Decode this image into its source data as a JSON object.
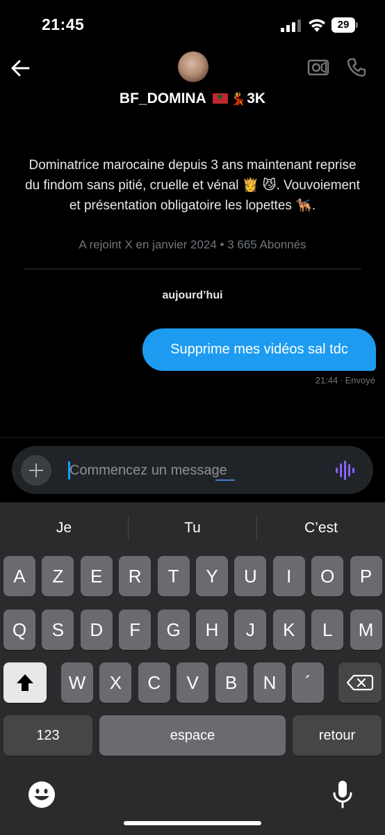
{
  "status_bar": {
    "time": "21:45",
    "battery": "29"
  },
  "header": {
    "username": "BF_DOMINA",
    "username_suffix": "3K",
    "flag": "morocco-flag",
    "emoji": "dancer-emoji"
  },
  "bio": {
    "text": "Dominatrice marocaine depuis 3 ans maintenant reprise du findom sans pitié, cruelle et vénal 👸 😼. Vouvoiement et présentation obligatoire les lopettes 🐕‍🦺.",
    "meta": "A rejoint X en janvier 2024 • 3 665 Abonnés"
  },
  "conversation": {
    "day_label": "aujourd’hui",
    "messages": [
      {
        "text": "Supprime mes vidéos sal tdc",
        "time": "21:44",
        "status": "Envoyé"
      }
    ]
  },
  "composer": {
    "placeholder": "Commencez un message"
  },
  "keyboard": {
    "suggestions": [
      "Je",
      "Tu",
      "C’est"
    ],
    "row1": [
      "A",
      "Z",
      "E",
      "R",
      "T",
      "Y",
      "U",
      "I",
      "O",
      "P"
    ],
    "row2": [
      "Q",
      "S",
      "D",
      "F",
      "G",
      "H",
      "J",
      "K",
      "L",
      "M"
    ],
    "row3": [
      "W",
      "X",
      "C",
      "V",
      "B",
      "N",
      "´"
    ],
    "numbers_key": "123",
    "space_key": "espace",
    "return_key": "retour"
  },
  "colors": {
    "accent": "#1d9bf0",
    "background": "#000000",
    "keyboard": "#2b2b2d"
  }
}
